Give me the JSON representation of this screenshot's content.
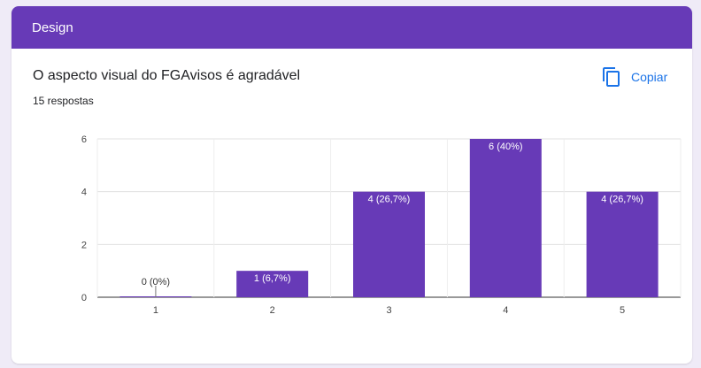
{
  "section": {
    "title": "Design"
  },
  "question": {
    "text": "O aspecto visual do FGAvisos é agradável",
    "responses": "15 respostas"
  },
  "copy": {
    "label": "Copiar"
  },
  "colors": {
    "bar": "#673ab7",
    "header": "#673ab7",
    "accent": "#1a73e8"
  },
  "chart_data": {
    "type": "bar",
    "categories": [
      "1",
      "2",
      "3",
      "4",
      "5"
    ],
    "values": [
      0,
      1,
      4,
      6,
      4
    ],
    "data_labels": [
      "0 (0%)",
      "1 (6,7%)",
      "4 (26,7%)",
      "6 (40%)",
      "4 (26,7%)"
    ],
    "yticks": [
      "0",
      "2",
      "4",
      "6"
    ],
    "ylim": [
      0,
      6
    ],
    "grid": true
  }
}
